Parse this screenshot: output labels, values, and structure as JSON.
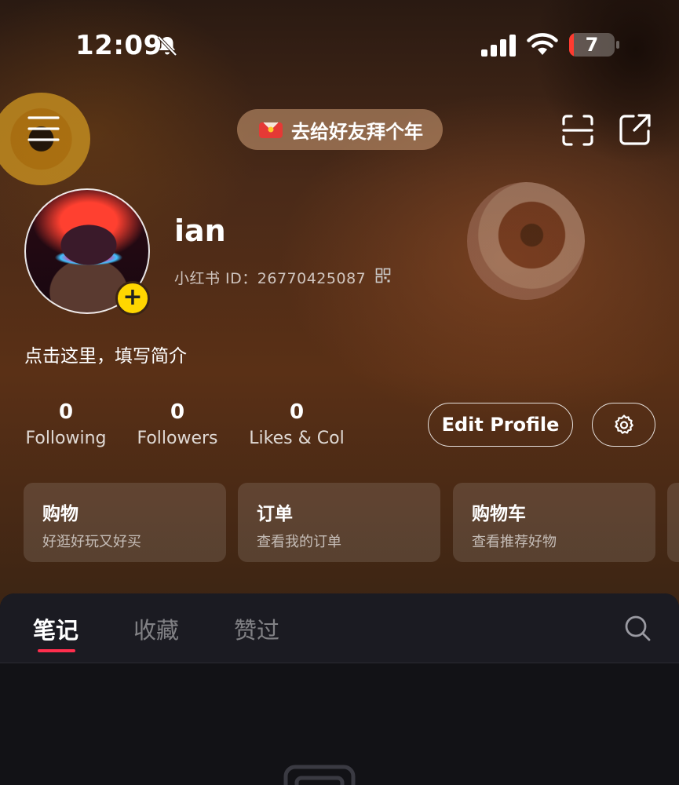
{
  "status_bar": {
    "time": "12:09",
    "battery": "7",
    "battery_color": "#ff3b30"
  },
  "header": {
    "banner_text": "去给好友拜个年"
  },
  "profile": {
    "username": "ian",
    "id_line": "小红书 ID：26770425087",
    "bio": "点击这里，填写简介",
    "avatar_add": "+"
  },
  "stats": [
    {
      "value": "0",
      "label": "Following"
    },
    {
      "value": "0",
      "label": "Followers"
    },
    {
      "value": "0",
      "label": "Likes & Col"
    }
  ],
  "actions": {
    "edit_profile": "Edit Profile"
  },
  "cards": [
    {
      "title": "购物",
      "subtitle": "好逛好玩又好买"
    },
    {
      "title": "订单",
      "subtitle": "查看我的订单"
    },
    {
      "title": "购物车",
      "subtitle": "查看推荐好物"
    }
  ],
  "tabs": [
    {
      "label": "笔记",
      "active": true
    },
    {
      "label": "收藏",
      "active": false
    },
    {
      "label": "赞过",
      "active": false
    }
  ],
  "colors": {
    "accent": "#ff2e4d",
    "avatar_badge": "#ffd600"
  },
  "icons": [
    "bell-off-icon",
    "signal-icon",
    "wifi-icon",
    "battery-icon",
    "menu-icon",
    "envelope-icon",
    "scan-icon",
    "share-icon",
    "qr-code-icon",
    "settings-icon",
    "search-icon",
    "empty-notes-icon"
  ]
}
